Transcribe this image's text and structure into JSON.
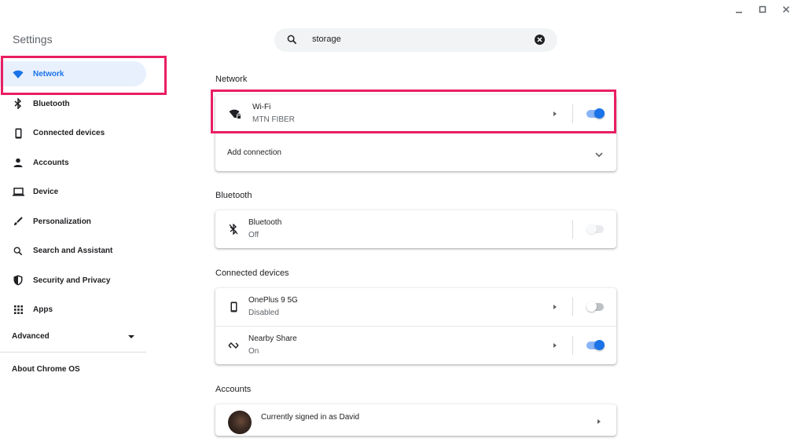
{
  "window": {
    "title": "Settings",
    "controls": {
      "minimize_icon": "minimize-icon",
      "maximize_icon": "maximize-icon",
      "close_icon": "close-icon"
    }
  },
  "search": {
    "value": "storage",
    "icon": "search-icon",
    "clear_icon": "clear-icon"
  },
  "sidebar": {
    "items": [
      {
        "label": "Network",
        "icon": "wifi-icon",
        "active": true
      },
      {
        "label": "Bluetooth",
        "icon": "bluetooth-icon"
      },
      {
        "label": "Connected devices",
        "icon": "phone-icon"
      },
      {
        "label": "Accounts",
        "icon": "person-icon"
      },
      {
        "label": "Device",
        "icon": "laptop-icon"
      },
      {
        "label": "Personalization",
        "icon": "brush-icon"
      },
      {
        "label": "Search and Assistant",
        "icon": "search-icon"
      },
      {
        "label": "Security and Privacy",
        "icon": "shield-icon"
      },
      {
        "label": "Apps",
        "icon": "apps-grid-icon"
      }
    ],
    "advanced_label": "Advanced",
    "about_label": "About Chrome OS"
  },
  "main": {
    "network": {
      "title": "Network",
      "wifi": {
        "title": "Wi-Fi",
        "subtitle": "MTN FIBER",
        "enabled": true
      },
      "add_connection": "Add connection"
    },
    "bluetooth": {
      "title": "Bluetooth",
      "row": {
        "title": "Bluetooth",
        "subtitle": "Off",
        "enabled": false
      }
    },
    "connected_devices": {
      "title": "Connected devices",
      "phone": {
        "title": "OnePlus 9 5G",
        "subtitle": "Disabled",
        "enabled": false
      },
      "nearby": {
        "title": "Nearby Share",
        "subtitle": "On",
        "enabled": true
      }
    },
    "accounts": {
      "title": "Accounts",
      "signed_in": "Currently signed in as David"
    }
  },
  "colors": {
    "accent": "#1a73e8",
    "highlight": "#e91e63",
    "active_bg": "#e8f0fe"
  }
}
